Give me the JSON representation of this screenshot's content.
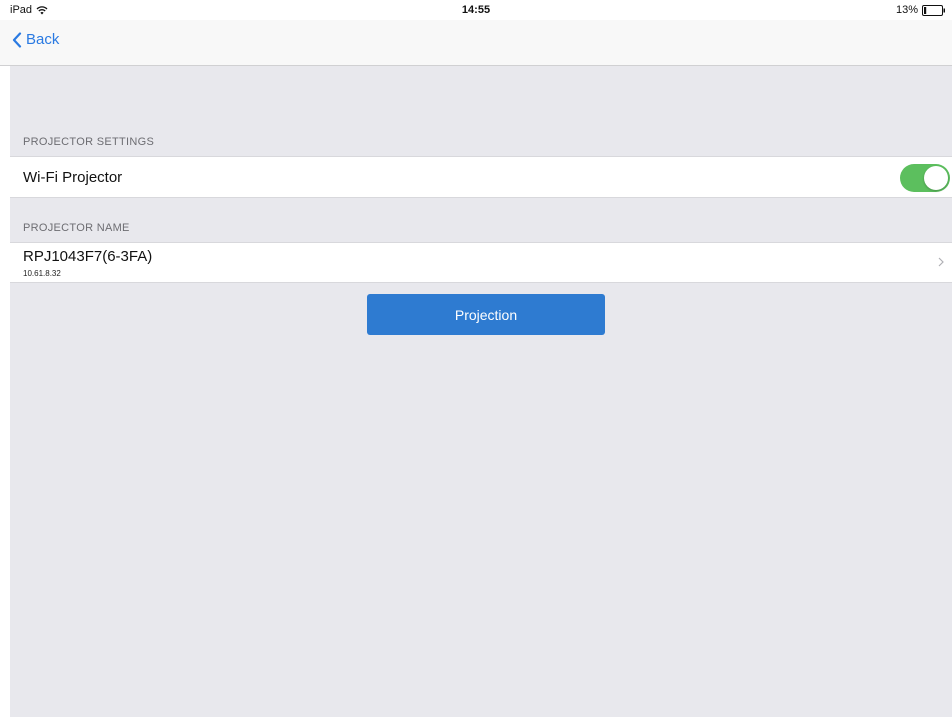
{
  "status_bar": {
    "device": "iPad",
    "time": "14:55",
    "battery": "13%",
    "wifi_icon": "wifi-icon",
    "battery_icon": "battery-icon",
    "battery_level": 0.13
  },
  "nav": {
    "back_label": "Back",
    "back_icon": "chevron-left-icon"
  },
  "sections": {
    "projector_settings": {
      "header": "PROJECTOR SETTINGS",
      "wifi_projector_label": "Wi-Fi Projector",
      "wifi_projector_enabled": true
    },
    "projector_name": {
      "header": "PROJECTOR NAME",
      "name": "RPJ1043F7(6-3FA)",
      "ip": "10.61.8.32"
    }
  },
  "actions": {
    "projection_label": "Projection"
  },
  "colors": {
    "accent": "#2a7ae2",
    "button": "#2e7bd1",
    "toggle_on": "#5cbf5e",
    "background": "#e8e8ed"
  }
}
